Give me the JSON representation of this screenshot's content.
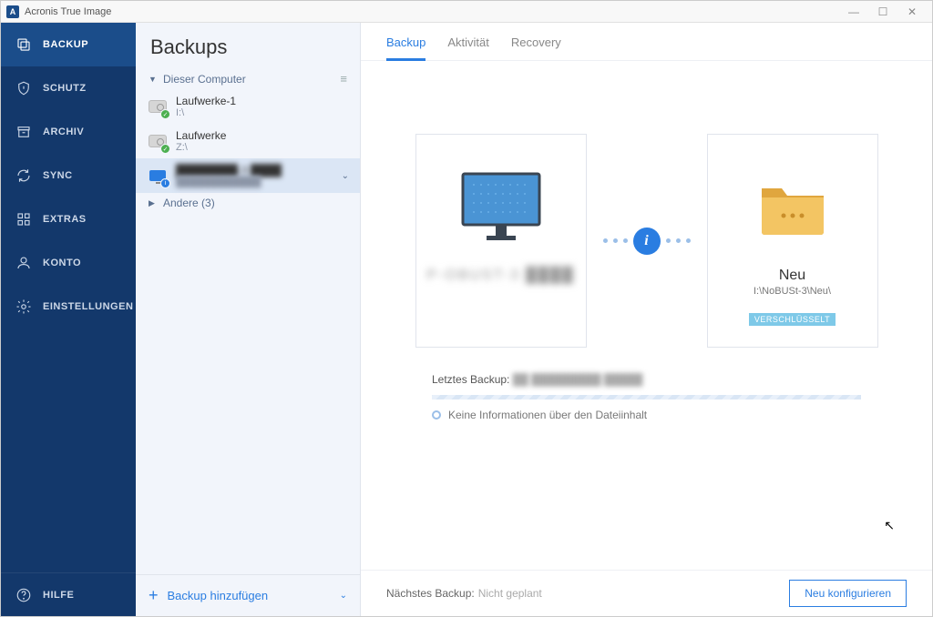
{
  "app": {
    "title": "Acronis True Image"
  },
  "sidebar": {
    "items": [
      {
        "label": "BACKUP"
      },
      {
        "label": "SCHUTZ"
      },
      {
        "label": "ARCHIV"
      },
      {
        "label": "SYNC"
      },
      {
        "label": "EXTRAS"
      },
      {
        "label": "KONTO"
      },
      {
        "label": "EINSTELLUNGEN"
      }
    ],
    "help": "HILFE"
  },
  "list": {
    "header": "Backups",
    "group_this": "Dieser Computer",
    "items": [
      {
        "title": "Laufwerke-1",
        "sub": "I:\\"
      },
      {
        "title": "Laufwerke",
        "sub": "Z:\\"
      },
      {
        "title": "████████-3 ████",
        "sub": "████████████"
      }
    ],
    "group_other": "Andere (3)",
    "add": "Backup hinzufügen"
  },
  "tabs": [
    {
      "label": "Backup"
    },
    {
      "label": "Aktivität"
    },
    {
      "label": "Recovery"
    }
  ],
  "source": {
    "title": "P-OBUST-3 ████"
  },
  "dest": {
    "title": "Neu",
    "path": "I:\\NoBUSt-3\\Neu\\",
    "badge": "VERSCHLÜSSELT"
  },
  "status": {
    "last_label": "Letztes Backup:",
    "last_value": "██ █████████ █████",
    "info": "Keine Informationen über den Dateiinhalt"
  },
  "footer": {
    "next_label": "Nächstes Backup:",
    "next_value": "Nicht geplant",
    "configure": "Neu konfigurieren"
  }
}
